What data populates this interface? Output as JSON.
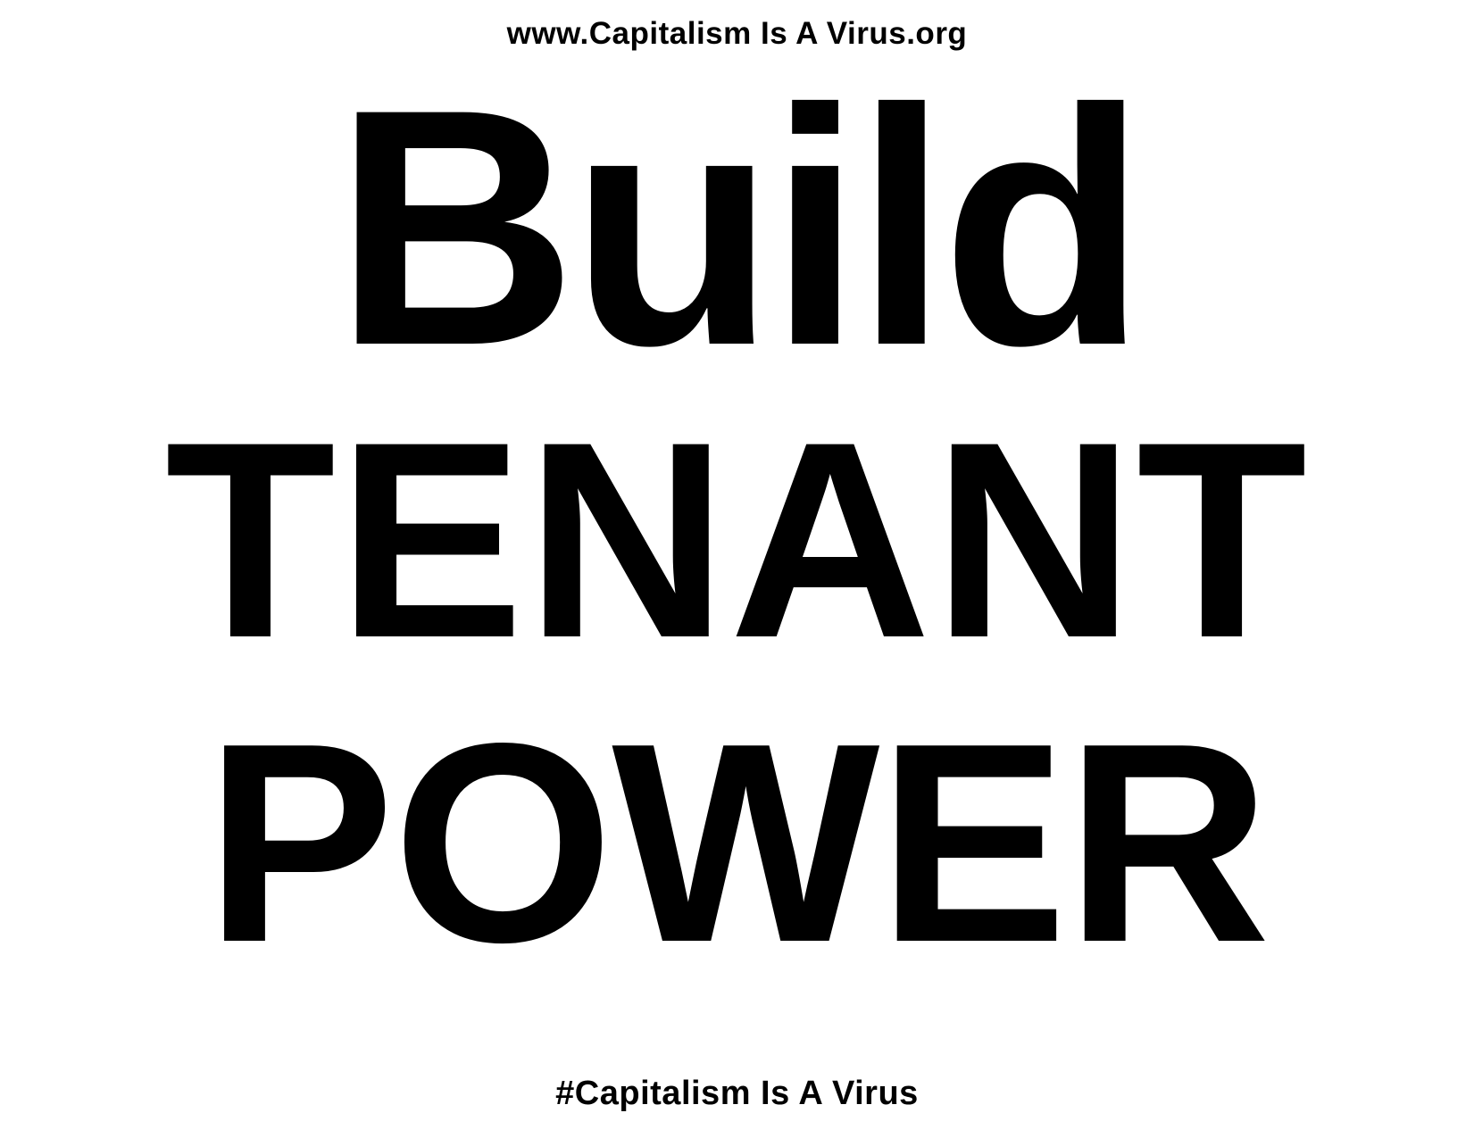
{
  "header": {
    "url": "www.Capitalism Is A Virus.org"
  },
  "headline": {
    "line1": "Build",
    "line2": "TENANT",
    "line3": "POWER"
  },
  "footer": {
    "hashtag": "#Capitalism Is A Virus"
  },
  "colors": {
    "background": "#ffffff",
    "text": "#000000"
  }
}
